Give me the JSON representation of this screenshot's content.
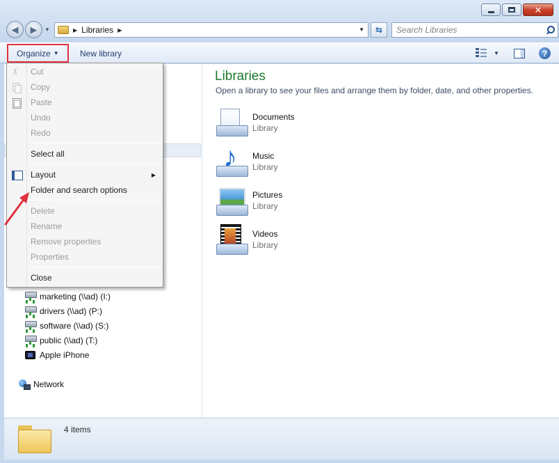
{
  "window": {
    "controls": {
      "minimize": "minimize",
      "maximize": "maximize",
      "close": "close"
    }
  },
  "address_bar": {
    "path": "Libraries",
    "search_placeholder": "Search Libraries"
  },
  "command_bar": {
    "organize_label": "Organize",
    "new_library_label": "New library"
  },
  "organize_menu": {
    "items": [
      {
        "label": "Cut",
        "enabled": false,
        "icon": "scissors-icon"
      },
      {
        "label": "Copy",
        "enabled": false,
        "icon": "copy-icon"
      },
      {
        "label": "Paste",
        "enabled": false,
        "icon": "paste-icon"
      },
      {
        "label": "Undo",
        "enabled": false
      },
      {
        "label": "Redo",
        "enabled": false
      },
      {
        "label": "Select all",
        "enabled": true
      },
      {
        "label": "Layout",
        "enabled": true,
        "icon": "layout-icon",
        "submenu": true
      },
      {
        "label": "Folder and search options",
        "enabled": true
      },
      {
        "label": "Delete",
        "enabled": false
      },
      {
        "label": "Rename",
        "enabled": false
      },
      {
        "label": "Remove properties",
        "enabled": false
      },
      {
        "label": "Properties",
        "enabled": false
      },
      {
        "label": "Close",
        "enabled": true
      }
    ]
  },
  "navigation_pane": {
    "drives": [
      {
        "label": "marketing (\\\\ad) (I:)",
        "icon": "network-drive-icon"
      },
      {
        "label": "drivers (\\\\ad) (P:)",
        "icon": "network-drive-icon"
      },
      {
        "label": "software (\\\\ad) (S:)",
        "icon": "network-drive-icon"
      },
      {
        "label": "public (\\\\ad) (T:)",
        "icon": "network-drive-icon"
      },
      {
        "label": "Apple iPhone",
        "icon": "iphone-icon"
      }
    ],
    "network_label": "Network"
  },
  "content": {
    "title": "Libraries",
    "subtitle": "Open a library to see your files and arrange them by folder, date, and other properties.",
    "libraries": [
      {
        "name": "Documents",
        "type": "Library",
        "icon": "documents-library-icon"
      },
      {
        "name": "Music",
        "type": "Library",
        "icon": "music-library-icon"
      },
      {
        "name": "Pictures",
        "type": "Library",
        "icon": "pictures-library-icon"
      },
      {
        "name": "Videos",
        "type": "Library",
        "icon": "videos-library-icon"
      }
    ]
  },
  "status_bar": {
    "item_count": "4 items"
  },
  "colors": {
    "title_green": "#1e7a2e",
    "highlight_red": "#e0313d",
    "link_blue": "#1e3d6c"
  }
}
